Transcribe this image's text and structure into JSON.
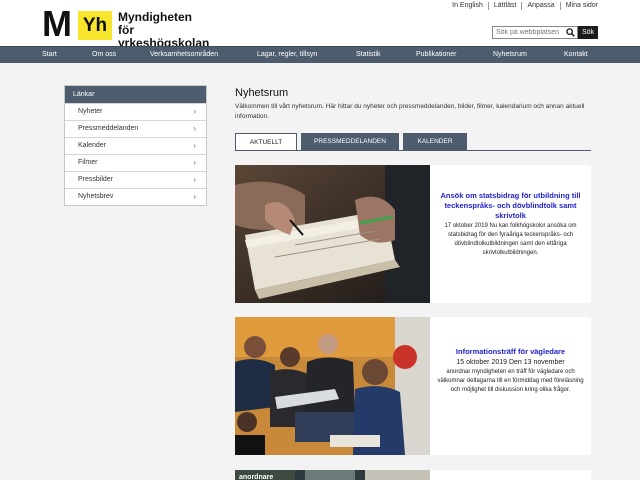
{
  "header": {
    "logo_letter": "M",
    "logo_badge": "Yh",
    "logo_line1": "Myndigheten för",
    "logo_line2": "yrkeshögskolan",
    "top_links": [
      "In English",
      "Lättläst",
      "Anpassa",
      "Mina sidor"
    ],
    "search_placeholder": "Sök på webbplatsen",
    "search_button": "Sök"
  },
  "nav": {
    "items": [
      "Start",
      "Om oss",
      "Verksamhetsområden",
      "Lagar, regler, tillsyn",
      "Statistik",
      "Publikationer",
      "Nyhetsrum",
      "Kontakt"
    ]
  },
  "sidebar": {
    "heading": "Länkar",
    "items": [
      "Nyheter",
      "Pressmeddelanden",
      "Kalender",
      "Filmer",
      "Pressbilder",
      "Nyhetsbrev"
    ]
  },
  "main": {
    "title": "Nyhetsrum",
    "intro": "Välkommen till vårt nyhetsrum. Här hittar du nyheter och pressmeddelanden, bilder, filmer, kalendarium och annan aktuell information.",
    "tabs": [
      "AKTUELLT",
      "PRESSMEDDELANDEN",
      "KALENDER"
    ],
    "news": [
      {
        "title": "Ansök om statsbidrag för utbildning till teckenspråks- och dövblindtolk samt skrivtolk",
        "text": "17 oktober 2019 Nu kan folkhögskolor ansöka om statsbidrag för den fyraåriga teckenspråks- och dövblindtolkutbildningen samt den ettåriga skrivtolkutbildningen."
      },
      {
        "title": "Informationsträff för vägledare",
        "date": "15 oktober 2019 Den 13 november",
        "text": "anordnar myndigheten en träff för vägledare och välkomnar deltagarna till en förmiddag med föreläsning och möjlighet till diskussion kring olika frågor."
      }
    ],
    "third_image_caption": "anordnare"
  },
  "colors": {
    "nav_bg": "#4d5d6d",
    "logo_yellow": "#f7e62b",
    "link_blue": "#2222cc",
    "page_bg": "#f3f3f3"
  }
}
